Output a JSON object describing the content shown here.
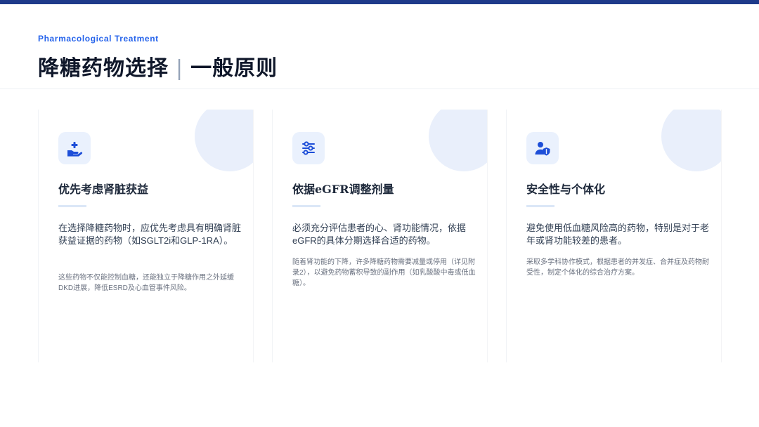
{
  "header": {
    "eyebrow": "Pharmacological Treatment",
    "title_main": "降糖药物选择",
    "title_sep": "|",
    "title_sub": "一般原则"
  },
  "cards": [
    {
      "icon": "hand-medical-icon",
      "title": "优先考虑肾脏获益",
      "desc": "在选择降糖药物时，应优先考虑具有明确肾脏获益证据的药物（如SGLT2i和GLP-1RA）。",
      "note": "这些药物不仅能控制血糖，还能独立于降糖作用之外延缓DKD进展，降低ESRD及心血管事件风险。"
    },
    {
      "icon": "sliders-icon",
      "title": "依据eGFR调整剂量",
      "desc": "必须充分评估患者的心、肾功能情况，依据eGFR的具体分期选择合适的药物。",
      "note": "随着肾功能的下降，许多降糖药物需要减量或停用（详见附录2），以避免药物蓄积导致的副作用（如乳酸酸中毒或低血糖）。"
    },
    {
      "icon": "user-shield-icon",
      "title": "安全性与个体化",
      "desc": "避免使用低血糖风险高的药物，特别是对于老年或肾功能较差的患者。",
      "note": "采取多学科协作模式，根据患者的并发症、合并症及药物耐受性，制定个体化的综合治疗方案。"
    }
  ],
  "colors": {
    "accent": "#2563eb",
    "top_bar": "#1e3a8a",
    "icon_bg": "#eaf1fd"
  }
}
